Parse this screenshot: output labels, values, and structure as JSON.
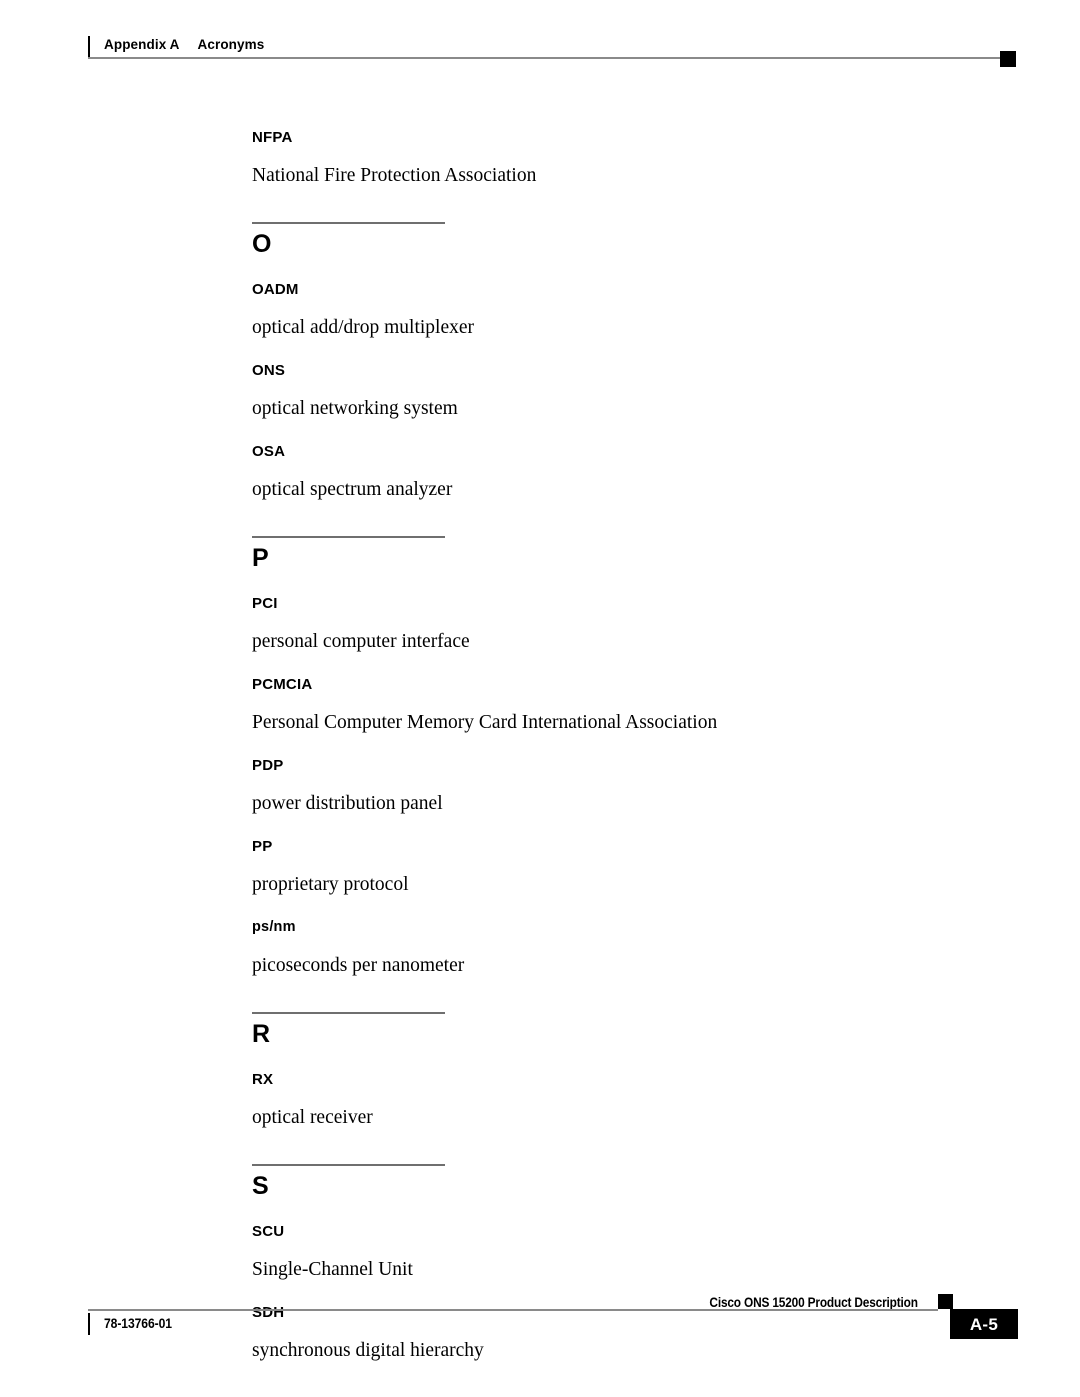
{
  "header": {
    "appendix_label": "Appendix A",
    "appendix_title": "Acronyms"
  },
  "content": {
    "lead_entries": [
      {
        "term": "NFPA",
        "definition": "National Fire Protection Association",
        "style": "upper"
      }
    ],
    "sections": [
      {
        "letter": "O",
        "entries": [
          {
            "term": "OADM",
            "definition": "optical add/drop multiplexer",
            "style": "upper"
          },
          {
            "term": "ONS",
            "definition": "optical networking system",
            "style": "upper"
          },
          {
            "term": "OSA",
            "definition": "optical spectrum analyzer",
            "style": "upper"
          }
        ]
      },
      {
        "letter": "P",
        "entries": [
          {
            "term": "PCI",
            "definition": "personal computer interface",
            "style": "upper"
          },
          {
            "term": "PCMCIA",
            "definition": "Personal Computer Memory Card International Association",
            "style": "upper"
          },
          {
            "term": "PDP",
            "definition": "power distribution panel",
            "style": "upper"
          },
          {
            "term": "PP",
            "definition": "proprietary protocol",
            "style": "upper"
          },
          {
            "term": "ps/nm",
            "definition": "picoseconds per nanometer",
            "style": "lower"
          }
        ]
      },
      {
        "letter": "R",
        "entries": [
          {
            "term": "RX",
            "definition": "optical receiver",
            "style": "upper"
          }
        ]
      },
      {
        "letter": "S",
        "entries": [
          {
            "term": "SCU",
            "definition": "Single-Channel Unit",
            "style": "upper"
          },
          {
            "term": "SDH",
            "definition": "synchronous digital hierarchy",
            "style": "upper"
          }
        ]
      }
    ]
  },
  "footer": {
    "document_title": "Cisco ONS 15200 Product Description",
    "document_number": "78-13766-01",
    "page_number": "A-5"
  }
}
